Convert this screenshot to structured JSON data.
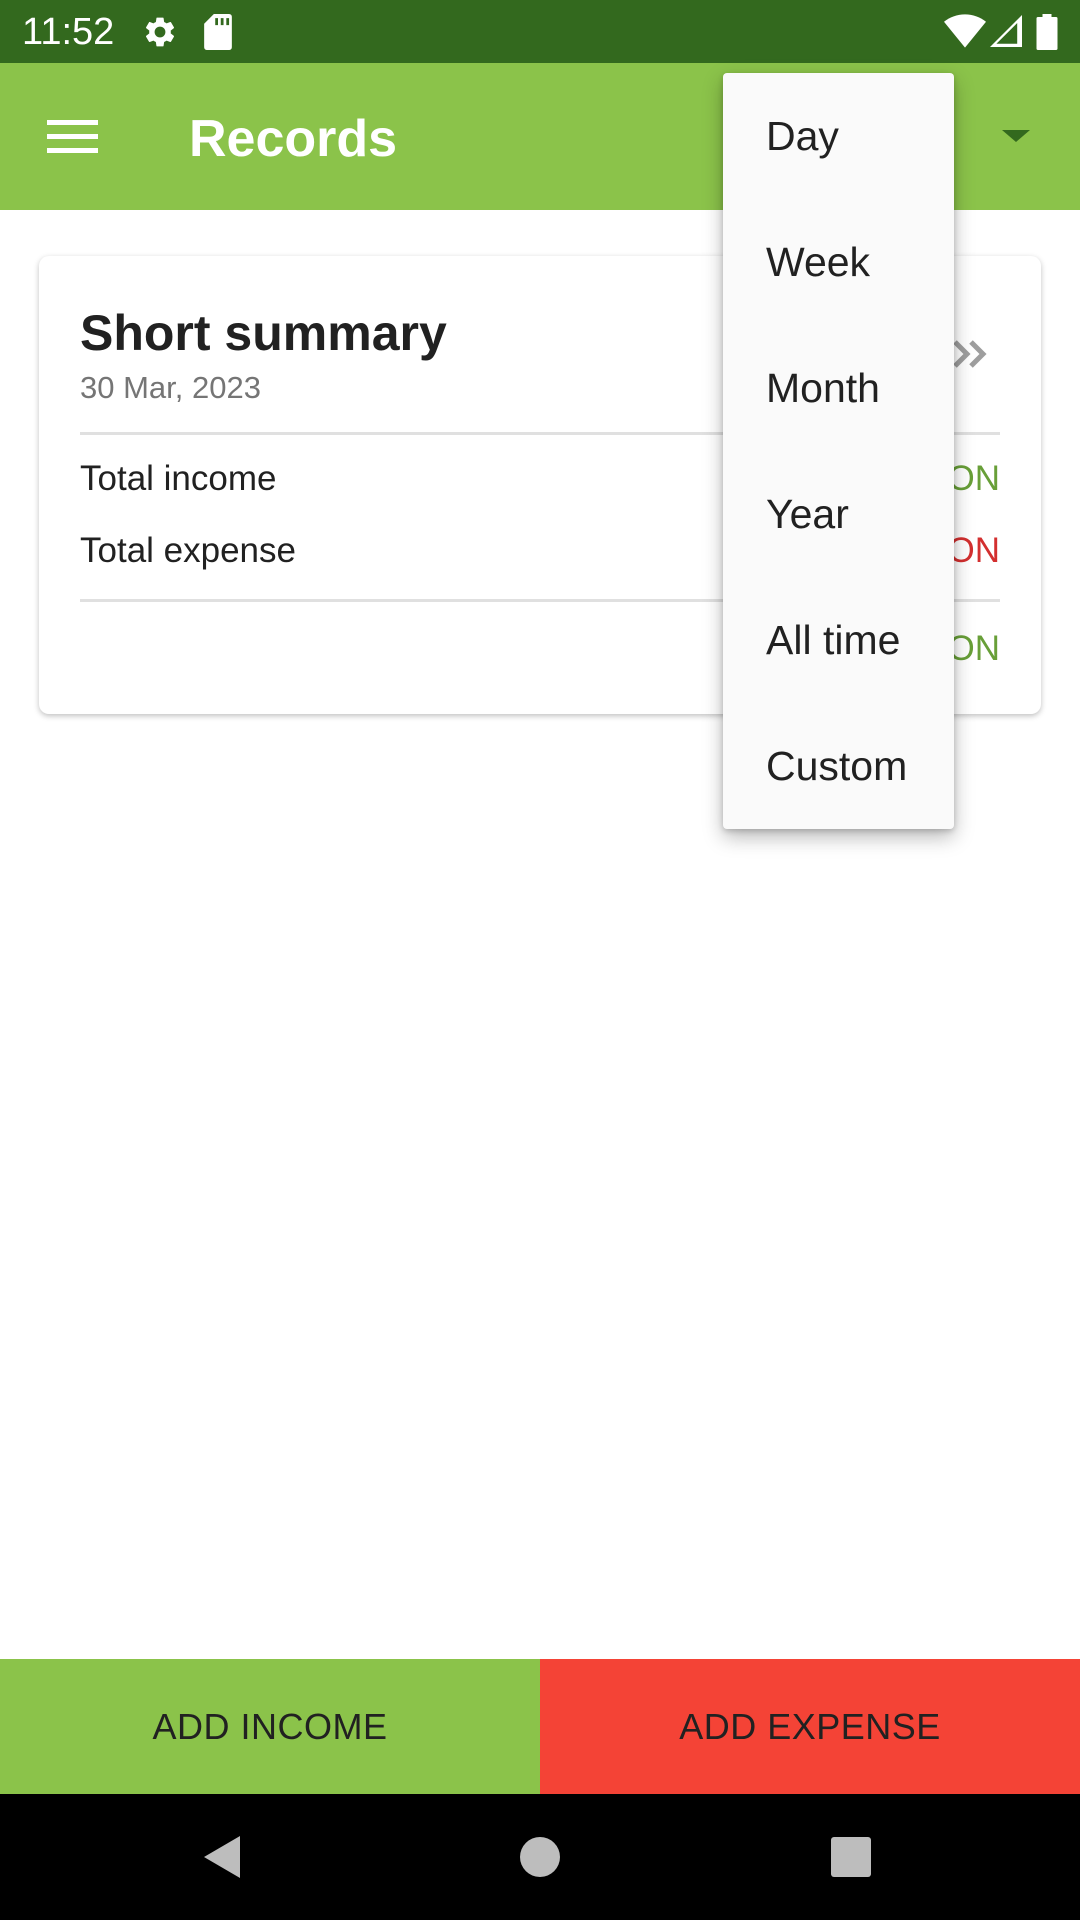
{
  "status_bar": {
    "time": "11:52",
    "left_icons": [
      "settings-gear-icon",
      "sd-card-icon"
    ],
    "right_icons": [
      "wifi-icon",
      "cell-signal-icon",
      "battery-icon"
    ],
    "color": "#33691e"
  },
  "app_bar": {
    "title": "Records",
    "menu_icon": "hamburger-menu-icon",
    "period_dropdown_icon": "dropdown-arrow-icon",
    "color": "#8bc34a"
  },
  "summary_card": {
    "title": "Short summary",
    "date": "30 Mar, 2023",
    "open_icon": "double-chevron-right-icon",
    "rows": [
      {
        "label": "Total income",
        "value_visible": "ON",
        "color": "#689f38"
      },
      {
        "label": "Total expense",
        "value_visible": "ON",
        "color": "#d32f2f"
      }
    ],
    "balance_value_visible": "ON",
    "balance_color": "#689f38"
  },
  "period_menu": {
    "items": [
      "Day",
      "Week",
      "Month",
      "Year",
      "All time",
      "Custom"
    ]
  },
  "bottom_actions": {
    "add_income": "ADD INCOME",
    "add_expense": "ADD EXPENSE",
    "income_color": "#8bc34a",
    "expense_color": "#f44336"
  },
  "nav_bar": {
    "buttons": [
      "back-icon",
      "home-icon",
      "recents-icon"
    ]
  }
}
